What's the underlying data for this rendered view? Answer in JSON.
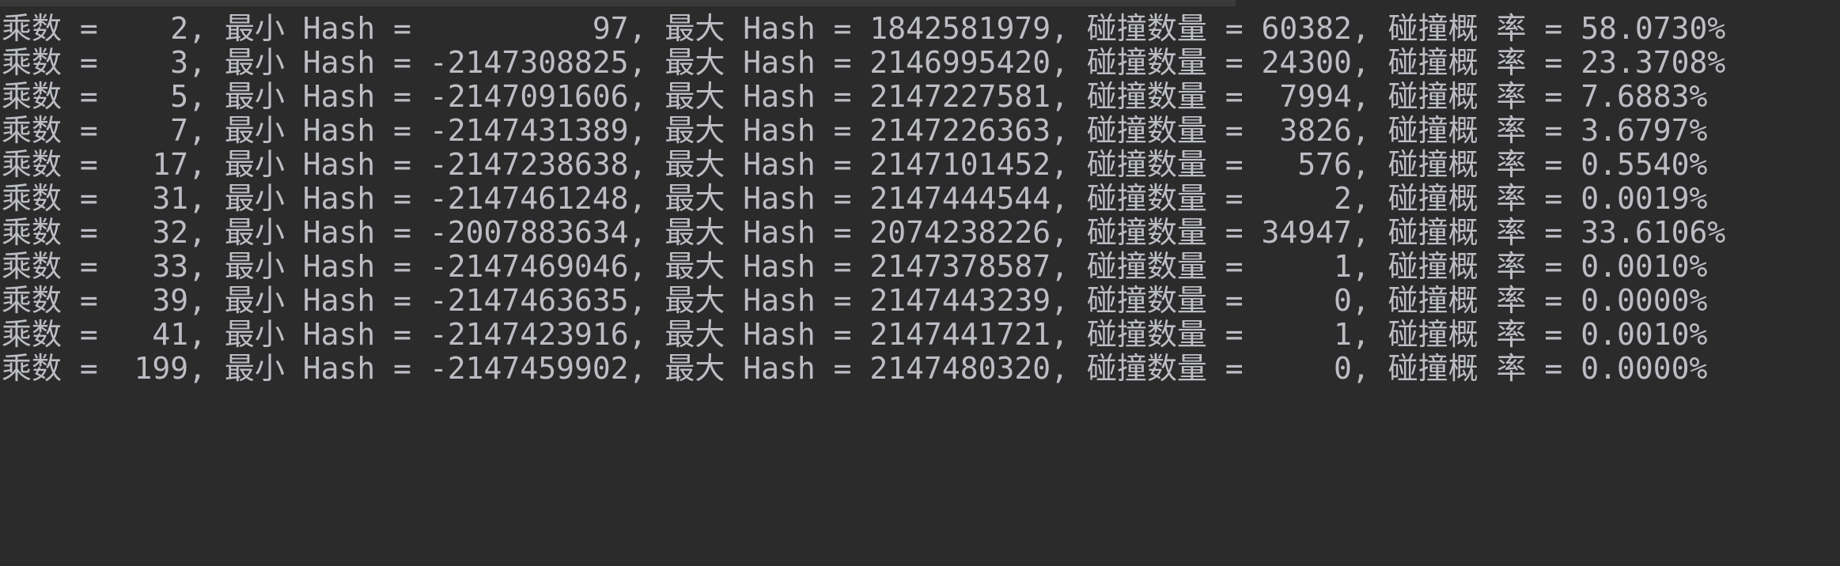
{
  "console": {
    "lines": [
      "乘数 =    2, 最小 Hash =          97, 最大 Hash = 1842581979, 碰撞数量 = 60382, 碰撞概 率 = 58.0730%",
      "乘数 =    3, 最小 Hash = -2147308825, 最大 Hash = 2146995420, 碰撞数量 = 24300, 碰撞概 率 = 23.3708%",
      "乘数 =    5, 最小 Hash = -2147091606, 最大 Hash = 2147227581, 碰撞数量 =  7994, 碰撞概 率 = 7.6883%",
      "乘数 =    7, 最小 Hash = -2147431389, 最大 Hash = 2147226363, 碰撞数量 =  3826, 碰撞概 率 = 3.6797%",
      "乘数 =   17, 最小 Hash = -2147238638, 最大 Hash = 2147101452, 碰撞数量 =   576, 碰撞概 率 = 0.5540%",
      "乘数 =   31, 最小 Hash = -2147461248, 最大 Hash = 2147444544, 碰撞数量 =     2, 碰撞概 率 = 0.0019%",
      "乘数 =   32, 最小 Hash = -2007883634, 最大 Hash = 2074238226, 碰撞数量 = 34947, 碰撞概 率 = 33.6106%",
      "乘数 =   33, 最小 Hash = -2147469046, 最大 Hash = 2147378587, 碰撞数量 =     1, 碰撞概 率 = 0.0010%",
      "乘数 =   39, 最小 Hash = -2147463635, 最大 Hash = 2147443239, 碰撞数量 =     0, 碰撞概 率 = 0.0000%",
      "乘数 =   41, 最小 Hash = -2147423916, 最大 Hash = 2147441721, 碰撞数量 =     1, 碰撞概 率 = 0.0010%",
      "乘数 =  199, 最小 Hash = -2147459902, 最大 Hash = 2147480320, 碰撞数量 =     0, 碰撞概 率 = 0.0000%"
    ]
  }
}
